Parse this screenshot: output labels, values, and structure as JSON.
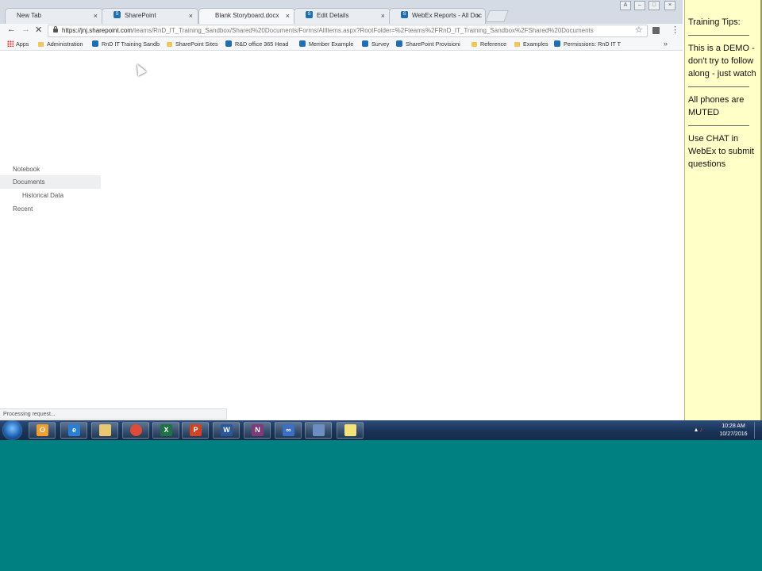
{
  "browser": {
    "tabs": [
      {
        "label": "New Tab",
        "icon": "blank",
        "active": false
      },
      {
        "label": "SharePoint",
        "icon": "sharepoint",
        "active": false
      },
      {
        "label": "Blank Storyboard.docx",
        "icon": "loading",
        "active": true
      },
      {
        "label": "Edit Details",
        "icon": "sharepoint",
        "active": false
      },
      {
        "label": "WebEx Reports - All Doc",
        "icon": "sharepoint",
        "active": false
      }
    ],
    "tab_close_glyph": "×",
    "url_host": "https://jnj.sharepoint.com",
    "url_path": "/teams/RnD_IT_Training_Sandbox/Shared%20Documents/Forms/AllItems.aspx?RootFolder=%2Fteams%2FRnD_IT_Training_Sandbox%2FShared%20Documents",
    "bookmarks": [
      {
        "label": "Apps",
        "icon": "apps"
      },
      {
        "label": "Administration",
        "icon": "folder"
      },
      {
        "label": "RnD IT Training Sandb",
        "icon": "sharepoint"
      },
      {
        "label": "SharePoint Sites",
        "icon": "folder"
      },
      {
        "label": "R&D office 365 Head",
        "icon": "sharepoint"
      },
      {
        "label": "Member Example",
        "icon": "sharepoint"
      },
      {
        "label": "Survey",
        "icon": "sharepoint"
      },
      {
        "label": "SharePoint Provisioni",
        "icon": "sharepoint"
      },
      {
        "label": "Reference",
        "icon": "folder"
      },
      {
        "label": "Examples",
        "icon": "folder"
      },
      {
        "label": "Permissions: RnD IT T",
        "icon": "sharepoint"
      }
    ],
    "bookmarks_more": "»",
    "status_text": "Processing request..."
  },
  "quick_launch": [
    {
      "label": "Notebook",
      "indent": false,
      "selected": false
    },
    {
      "label": "Documents",
      "indent": false,
      "selected": true
    },
    {
      "label": "Historical Data",
      "indent": true,
      "selected": false
    },
    {
      "label": "Recent",
      "indent": false,
      "selected": false
    }
  ],
  "tips": {
    "title": "Training Tips:",
    "items": [
      "This is a DEMO - don't try to follow along - just watch",
      "All phones are MUTED",
      "Use CHAT in WebEx to submit questions"
    ]
  },
  "taskbar": {
    "apps": [
      {
        "name": "outlook",
        "glyph": "O",
        "color": "#f0a030"
      },
      {
        "name": "internet-explorer",
        "glyph": "e",
        "color": "#2a7fd4"
      },
      {
        "name": "file-explorer",
        "glyph": "",
        "color": "#e8c872"
      },
      {
        "name": "chrome",
        "glyph": "",
        "color": "#dd4b39"
      },
      {
        "name": "excel",
        "glyph": "X",
        "color": "#1e7145"
      },
      {
        "name": "powerpoint",
        "glyph": "P",
        "color": "#d04423"
      },
      {
        "name": "word",
        "glyph": "W",
        "color": "#2b579a"
      },
      {
        "name": "onenote",
        "glyph": "N",
        "color": "#80397b"
      },
      {
        "name": "link-app",
        "glyph": "∞",
        "color": "#3a6fc4"
      },
      {
        "name": "robot-app",
        "glyph": "",
        "color": "#6a8fc0"
      },
      {
        "name": "sticky-notes",
        "glyph": "",
        "color": "#f4e37a"
      }
    ],
    "time": "10:28 AM",
    "date": "10/27/2016"
  },
  "colors": {
    "desktop_teal": "#008080",
    "tips_yellow": "#ffffc8",
    "sharepoint_blue": "#1f6fb4"
  }
}
